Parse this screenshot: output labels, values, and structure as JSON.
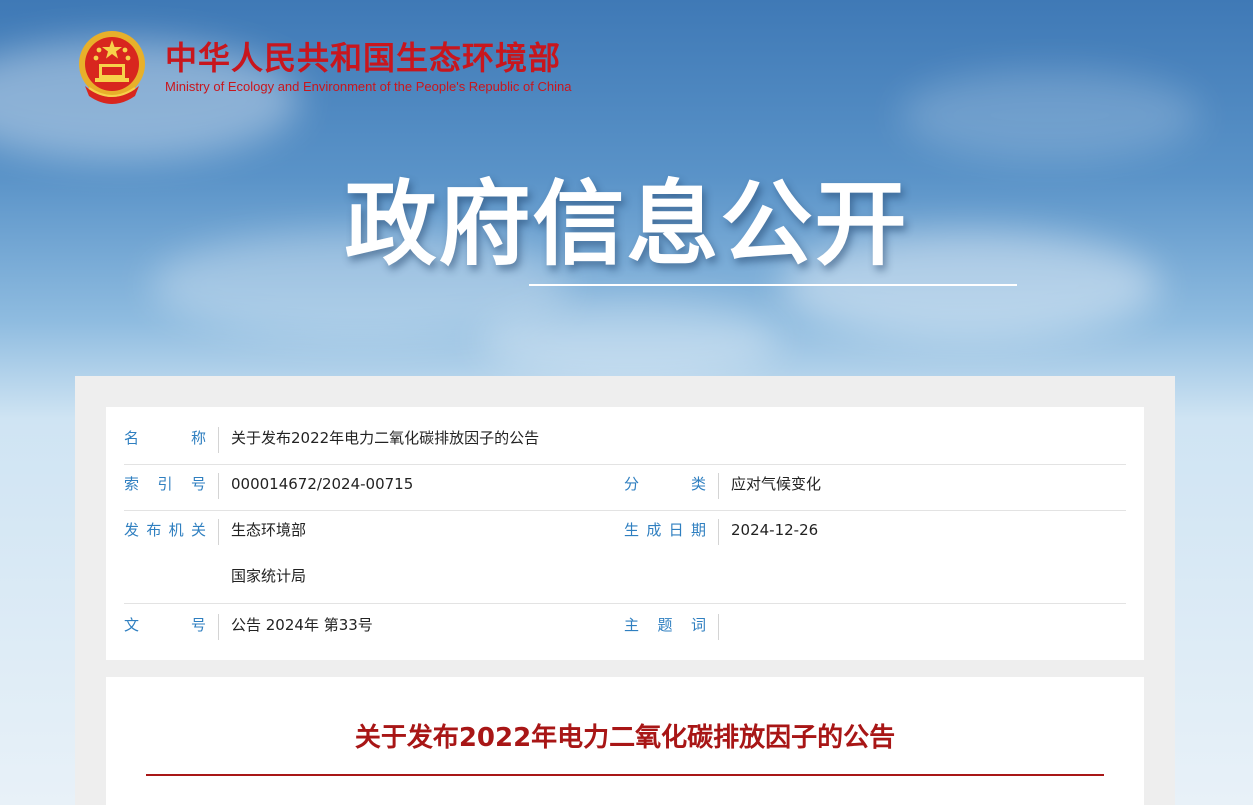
{
  "site": {
    "title": "中华人民共和国生态环境部",
    "title_en": "Ministry of Ecology and Environment of the People's Republic of China"
  },
  "banner": {
    "text": "政府信息公开"
  },
  "meta": {
    "name_label": "名　称",
    "name_value": "关于发布2022年电力二氧化碳排放因子的公告",
    "index_label": "索引号",
    "index_value": "000014672/2024-00715",
    "category_label": "分　类",
    "category_value": "应对气候变化",
    "publisher_label": "发布机关",
    "publisher_values": [
      "生态环境部",
      "国家统计局"
    ],
    "date_label": "生成日期",
    "date_value": "2024-12-26",
    "docno_label": "文　号",
    "docno_value": "公告 2024年 第33号",
    "keyword_label": "主题词",
    "keyword_value": ""
  },
  "article": {
    "title": "关于发布2022年电力二氧化碳排放因子的公告"
  },
  "colors": {
    "brand_red": "#c8161d",
    "label_blue": "#2f7fc0",
    "article_red": "#a81616"
  }
}
